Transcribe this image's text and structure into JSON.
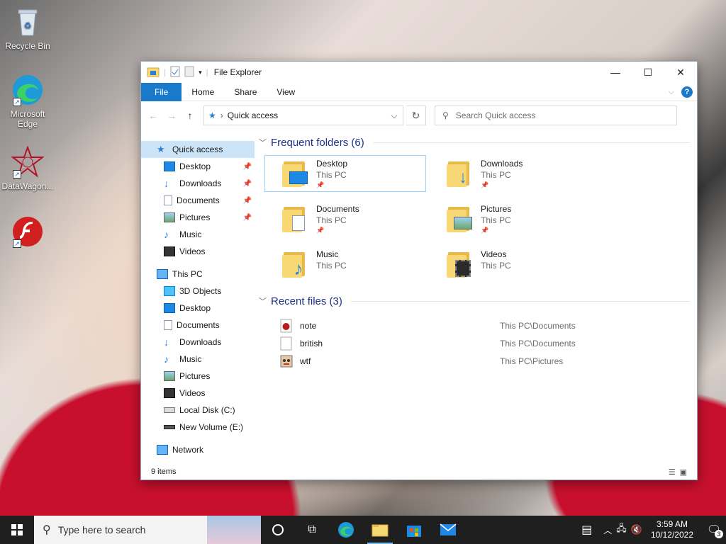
{
  "desktop": {
    "icons": [
      {
        "label": "Recycle Bin"
      },
      {
        "label": "Microsoft Edge"
      },
      {
        "label": "DataWagon..."
      },
      {
        "label": ""
      }
    ]
  },
  "window": {
    "title": "File Explorer",
    "ribbon_tabs": [
      "File",
      "Home",
      "Share",
      "View"
    ],
    "help_label": "?",
    "address_path": "Quick access",
    "search_placeholder": "Search Quick access",
    "nav": {
      "quick_access": "Quick access",
      "quick_items": [
        "Desktop",
        "Downloads",
        "Documents",
        "Pictures",
        "Music",
        "Videos"
      ],
      "this_pc": "This PC",
      "pc_items": [
        "3D Objects",
        "Desktop",
        "Documents",
        "Downloads",
        "Music",
        "Pictures",
        "Videos",
        "Local Disk (C:)",
        "New Volume (E:)"
      ],
      "network": "Network"
    },
    "frequent_header": "Frequent folders (6)",
    "frequent": [
      {
        "name": "Desktop",
        "location": "This PC",
        "pinned": true
      },
      {
        "name": "Downloads",
        "location": "This PC",
        "pinned": true
      },
      {
        "name": "Documents",
        "location": "This PC",
        "pinned": true
      },
      {
        "name": "Pictures",
        "location": "This PC",
        "pinned": true
      },
      {
        "name": "Music",
        "location": "This PC",
        "pinned": false
      },
      {
        "name": "Videos",
        "location": "This PC",
        "pinned": false
      }
    ],
    "recent_header": "Recent files (3)",
    "recent": [
      {
        "name": "note",
        "path": "This PC\\Documents"
      },
      {
        "name": "british",
        "path": "This PC\\Documents"
      },
      {
        "name": "wtf",
        "path": "This PC\\Pictures"
      }
    ],
    "status": "9 items"
  },
  "taskbar": {
    "search_placeholder": "Type here to search",
    "time": "3:59 AM",
    "date": "10/12/2022",
    "notification_count": "3"
  },
  "colors": {
    "accent": "#1979ca",
    "selection": "#cce4f7",
    "folder": "#f8d775"
  }
}
